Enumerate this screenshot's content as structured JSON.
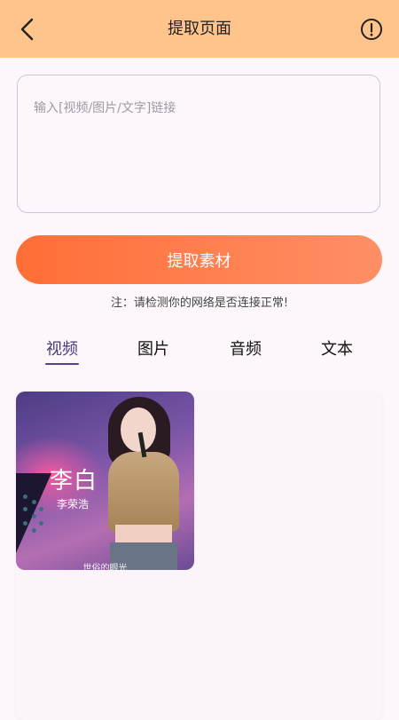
{
  "header": {
    "title": "提取页面",
    "back_icon": "chevron-left-icon",
    "info_icon": "info-circle-icon",
    "background": "#ffc48b"
  },
  "link_input": {
    "value": "",
    "placeholder": "输入[视频/图片/文字]链接"
  },
  "extract_button": {
    "label": "提取素材",
    "gradient": [
      "#ff6e36",
      "#ff8f66"
    ]
  },
  "note": "注：请检测你的网络是否连接正常!",
  "tabs": [
    {
      "label": "视频",
      "active": true
    },
    {
      "label": "图片",
      "active": false
    },
    {
      "label": "音频",
      "active": false
    },
    {
      "label": "文本",
      "active": false
    }
  ],
  "media": {
    "items": [
      {
        "type": "video",
        "overlay_title": "李白",
        "overlay_artist": "李荣浩",
        "caption": "世俗的眼光"
      }
    ]
  }
}
